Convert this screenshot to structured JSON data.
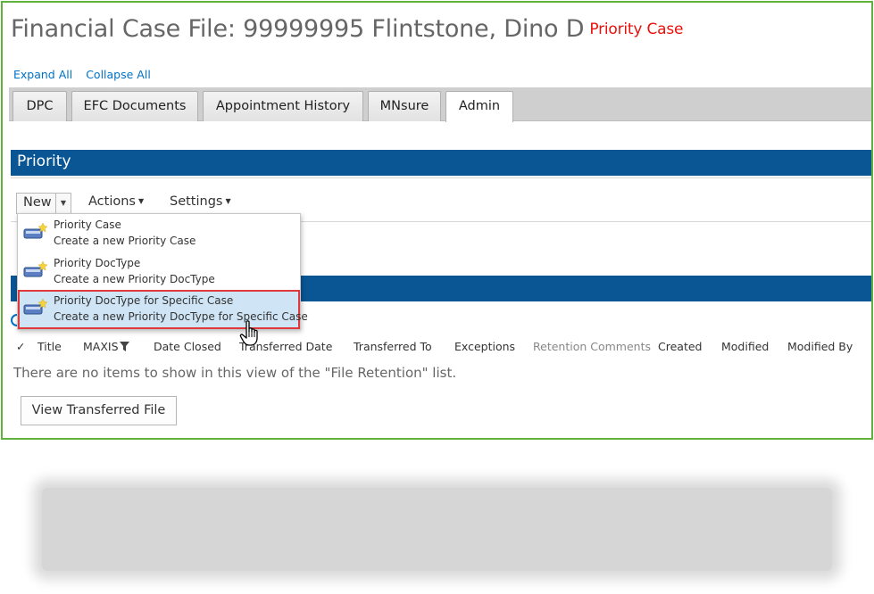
{
  "header": {
    "title": "Financial Case File: 99999995 Flintstone, Dino D",
    "badge": "Priority Case",
    "badge_color": "#e8120c"
  },
  "expand_links": {
    "expand_all": "Expand All",
    "collapse_all": "Collapse All"
  },
  "tabs": [
    {
      "label": "DPC",
      "active": false
    },
    {
      "label": "EFC Documents",
      "active": false
    },
    {
      "label": "Appointment History",
      "active": false
    },
    {
      "label": "MNsure",
      "active": false
    },
    {
      "label": "Admin",
      "active": true
    }
  ],
  "priority_section": {
    "title": "Priority",
    "bar_color": "#0a5594"
  },
  "toolbar": {
    "new_label": "New",
    "actions_label": "Actions",
    "settings_label": "Settings"
  },
  "new_menu": [
    {
      "title": "Priority Case",
      "description": "Create a new Priority Case",
      "highlighted": false
    },
    {
      "title": "Priority DocType",
      "description": "Create a new Priority DocType",
      "highlighted": false
    },
    {
      "title": "Priority DocType for Specific Case",
      "description": "Create a new Priority DocType for Specific Case",
      "highlighted": true
    }
  ],
  "file_retention": {
    "columns": [
      "Title",
      "MAXIS",
      "Date Closed",
      "Transferred Date",
      "Transferred To",
      "Exceptions",
      "Retention Comments",
      "Created",
      "Modified",
      "Modified By"
    ],
    "empty_message": "There are no items to show in this view of the \"File Retention\" list.",
    "view_button": "View Transferred File"
  },
  "icons": [
    "new-item-icon",
    "dropdown-arrow-icon",
    "filter-icon",
    "checkmark-icon",
    "hand-cursor-icon"
  ]
}
